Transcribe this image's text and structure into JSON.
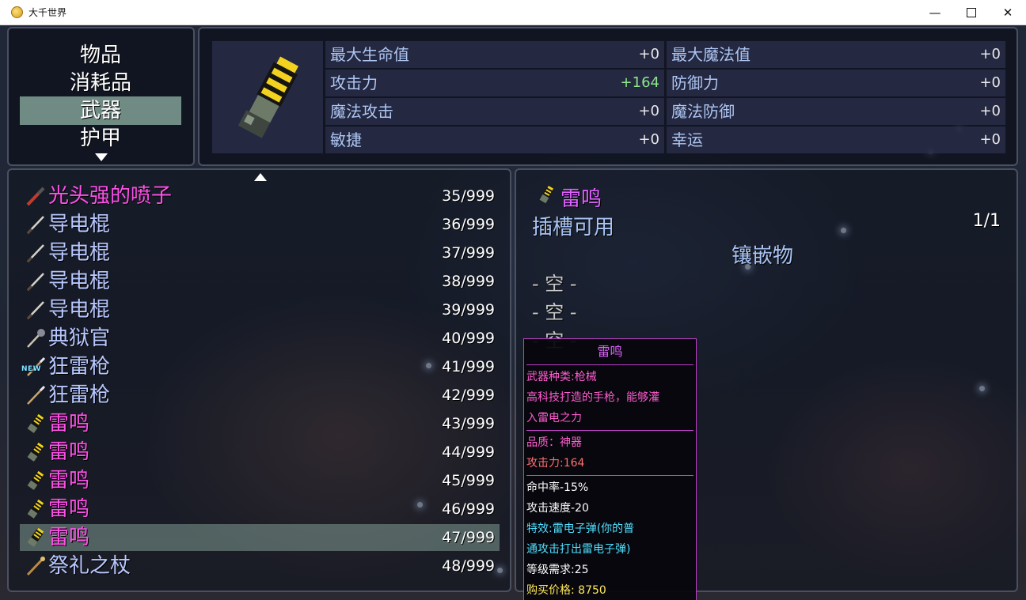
{
  "window": {
    "title": "大千世界",
    "controls": {
      "minimize": "—",
      "close": "✕"
    }
  },
  "categories": [
    {
      "label": "物品",
      "selected": false
    },
    {
      "label": "消耗品",
      "selected": false
    },
    {
      "label": "武器",
      "selected": true
    },
    {
      "label": "护甲",
      "selected": false
    }
  ],
  "stats": {
    "left": [
      {
        "label": "最大生命值",
        "value": "+0",
        "increased": false
      },
      {
        "label": "攻击力",
        "value": "+164",
        "increased": true
      },
      {
        "label": "魔法攻击",
        "value": "+0",
        "increased": false
      },
      {
        "label": "敏捷",
        "value": "+0",
        "increased": false
      }
    ],
    "right": [
      {
        "label": "最大魔法值",
        "value": "+0"
      },
      {
        "label": "防御力",
        "value": "+0"
      },
      {
        "label": "魔法防御",
        "value": "+0"
      },
      {
        "label": "幸运",
        "value": "+0"
      }
    ]
  },
  "items": [
    {
      "name": "光头强的喷子",
      "qty": "35/999",
      "color": "#ff50e8",
      "icon": "shotgun-icon"
    },
    {
      "name": "导电棍",
      "qty": "36/999",
      "color": "#b8c8ff",
      "icon": "baton-icon"
    },
    {
      "name": "导电棍",
      "qty": "37/999",
      "color": "#b8c8ff",
      "icon": "baton-icon"
    },
    {
      "name": "导电棍",
      "qty": "38/999",
      "color": "#b8c8ff",
      "icon": "baton-icon"
    },
    {
      "name": "导电棍",
      "qty": "39/999",
      "color": "#b8c8ff",
      "icon": "baton-icon"
    },
    {
      "name": "典狱官",
      "qty": "40/999",
      "color": "#b8c8ff",
      "icon": "mace-icon"
    },
    {
      "name": "狂雷枪",
      "qty": "41/999",
      "color": "#b8c8ff",
      "icon": "spear-icon",
      "badge": "NEW"
    },
    {
      "name": "狂雷枪",
      "qty": "42/999",
      "color": "#b8c8ff",
      "icon": "spear-icon"
    },
    {
      "name": "雷鸣",
      "qty": "43/999",
      "color": "#ff50e8",
      "icon": "thunder-gun-icon"
    },
    {
      "name": "雷鸣",
      "qty": "44/999",
      "color": "#ff50e8",
      "icon": "thunder-gun-icon"
    },
    {
      "name": "雷鸣",
      "qty": "45/999",
      "color": "#ff50e8",
      "icon": "thunder-gun-icon"
    },
    {
      "name": "雷鸣",
      "qty": "46/999",
      "color": "#ff50e8",
      "icon": "thunder-gun-icon"
    },
    {
      "name": "雷鸣",
      "qty": "47/999",
      "color": "#ff50e8",
      "icon": "thunder-gun-icon",
      "selected": true
    },
    {
      "name": "祭礼之杖",
      "qty": "48/999",
      "color": "#b8c8ff",
      "icon": "staff-icon"
    }
  ],
  "detail": {
    "name": "雷鸣",
    "slot_label": "插槽可用",
    "slot_count": "1/1",
    "inlay_label": "镶嵌物",
    "empty_slots": [
      "- 空 -",
      "- 空 -",
      "- 空 -"
    ]
  },
  "tooltip": {
    "title": "雷鸣",
    "type": "武器种类:枪械",
    "desc1": "高科技打造的手枪，能够灌",
    "desc2": "入雷电之力",
    "quality": "品质：神器",
    "attack": "攻击力:164",
    "hit": "命中率-15%",
    "speed": "攻击速度-20",
    "special1": "特效:雷电子弹(你的普",
    "special2": "通攻击打出雷电子弹)",
    "level": "等级需求:25",
    "price": "购买价格: 8750"
  }
}
